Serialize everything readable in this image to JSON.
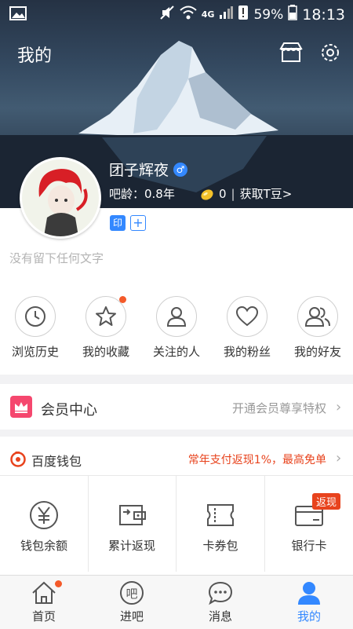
{
  "status_bar": {
    "network": "4G",
    "battery": "59%",
    "time": "18:13"
  },
  "header": {
    "title": "我的"
  },
  "profile": {
    "name": "团子辉夜",
    "gender_symbol": "♂",
    "age_label": "吧龄：0.8年",
    "tdou_count": "0",
    "get_tdou": "获取T豆>",
    "badge_yin": "印",
    "badge_add": "+",
    "signature": "没有留下任何文字"
  },
  "quick_actions": [
    {
      "label": "浏览历史",
      "icon": "clock-icon"
    },
    {
      "label": "我的收藏",
      "icon": "star-icon",
      "dot": true
    },
    {
      "label": "关注的人",
      "icon": "person-icon"
    },
    {
      "label": "我的粉丝",
      "icon": "heart-icon"
    },
    {
      "label": "我的好友",
      "icon": "friends-icon"
    }
  ],
  "vip": {
    "title": "会员中心",
    "subtitle": "开通会员尊享特权",
    "accent": "#f5476e"
  },
  "wallet": {
    "title": "百度钱包",
    "promo": "常年支付返现1%，最高免单",
    "accent": "#e8431d",
    "items": [
      {
        "label": "钱包余额",
        "icon": "yuan-icon"
      },
      {
        "label": "累计返现",
        "icon": "wallet-icon"
      },
      {
        "label": "卡券包",
        "icon": "ticket-icon"
      },
      {
        "label": "银行卡",
        "icon": "bank-card-icon",
        "tag": "返现"
      }
    ]
  },
  "tabs": [
    {
      "label": "首页",
      "icon": "home-icon",
      "dot": true
    },
    {
      "label": "进吧",
      "icon": "ba-icon",
      "glyph": "吧"
    },
    {
      "label": "消息",
      "icon": "message-icon"
    },
    {
      "label": "我的",
      "icon": "me-icon",
      "active": true
    }
  ],
  "colors": {
    "primary": "#3388ff",
    "hero_dark": "#253244"
  }
}
